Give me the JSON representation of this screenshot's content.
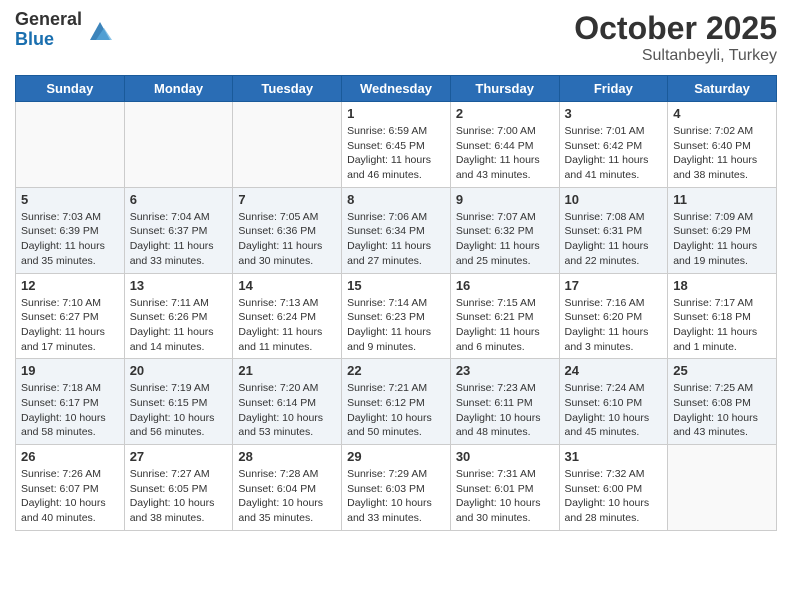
{
  "header": {
    "logo_general": "General",
    "logo_blue": "Blue",
    "month_title": "October 2025",
    "subtitle": "Sultanbeyli, Turkey"
  },
  "weekdays": [
    "Sunday",
    "Monday",
    "Tuesday",
    "Wednesday",
    "Thursday",
    "Friday",
    "Saturday"
  ],
  "weeks": [
    [
      {
        "day": "",
        "text": ""
      },
      {
        "day": "",
        "text": ""
      },
      {
        "day": "",
        "text": ""
      },
      {
        "day": "1",
        "text": "Sunrise: 6:59 AM\nSunset: 6:45 PM\nDaylight: 11 hours and 46 minutes."
      },
      {
        "day": "2",
        "text": "Sunrise: 7:00 AM\nSunset: 6:44 PM\nDaylight: 11 hours and 43 minutes."
      },
      {
        "day": "3",
        "text": "Sunrise: 7:01 AM\nSunset: 6:42 PM\nDaylight: 11 hours and 41 minutes."
      },
      {
        "day": "4",
        "text": "Sunrise: 7:02 AM\nSunset: 6:40 PM\nDaylight: 11 hours and 38 minutes."
      }
    ],
    [
      {
        "day": "5",
        "text": "Sunrise: 7:03 AM\nSunset: 6:39 PM\nDaylight: 11 hours and 35 minutes."
      },
      {
        "day": "6",
        "text": "Sunrise: 7:04 AM\nSunset: 6:37 PM\nDaylight: 11 hours and 33 minutes."
      },
      {
        "day": "7",
        "text": "Sunrise: 7:05 AM\nSunset: 6:36 PM\nDaylight: 11 hours and 30 minutes."
      },
      {
        "day": "8",
        "text": "Sunrise: 7:06 AM\nSunset: 6:34 PM\nDaylight: 11 hours and 27 minutes."
      },
      {
        "day": "9",
        "text": "Sunrise: 7:07 AM\nSunset: 6:32 PM\nDaylight: 11 hours and 25 minutes."
      },
      {
        "day": "10",
        "text": "Sunrise: 7:08 AM\nSunset: 6:31 PM\nDaylight: 11 hours and 22 minutes."
      },
      {
        "day": "11",
        "text": "Sunrise: 7:09 AM\nSunset: 6:29 PM\nDaylight: 11 hours and 19 minutes."
      }
    ],
    [
      {
        "day": "12",
        "text": "Sunrise: 7:10 AM\nSunset: 6:27 PM\nDaylight: 11 hours and 17 minutes."
      },
      {
        "day": "13",
        "text": "Sunrise: 7:11 AM\nSunset: 6:26 PM\nDaylight: 11 hours and 14 minutes."
      },
      {
        "day": "14",
        "text": "Sunrise: 7:13 AM\nSunset: 6:24 PM\nDaylight: 11 hours and 11 minutes."
      },
      {
        "day": "15",
        "text": "Sunrise: 7:14 AM\nSunset: 6:23 PM\nDaylight: 11 hours and 9 minutes."
      },
      {
        "day": "16",
        "text": "Sunrise: 7:15 AM\nSunset: 6:21 PM\nDaylight: 11 hours and 6 minutes."
      },
      {
        "day": "17",
        "text": "Sunrise: 7:16 AM\nSunset: 6:20 PM\nDaylight: 11 hours and 3 minutes."
      },
      {
        "day": "18",
        "text": "Sunrise: 7:17 AM\nSunset: 6:18 PM\nDaylight: 11 hours and 1 minute."
      }
    ],
    [
      {
        "day": "19",
        "text": "Sunrise: 7:18 AM\nSunset: 6:17 PM\nDaylight: 10 hours and 58 minutes."
      },
      {
        "day": "20",
        "text": "Sunrise: 7:19 AM\nSunset: 6:15 PM\nDaylight: 10 hours and 56 minutes."
      },
      {
        "day": "21",
        "text": "Sunrise: 7:20 AM\nSunset: 6:14 PM\nDaylight: 10 hours and 53 minutes."
      },
      {
        "day": "22",
        "text": "Sunrise: 7:21 AM\nSunset: 6:12 PM\nDaylight: 10 hours and 50 minutes."
      },
      {
        "day": "23",
        "text": "Sunrise: 7:23 AM\nSunset: 6:11 PM\nDaylight: 10 hours and 48 minutes."
      },
      {
        "day": "24",
        "text": "Sunrise: 7:24 AM\nSunset: 6:10 PM\nDaylight: 10 hours and 45 minutes."
      },
      {
        "day": "25",
        "text": "Sunrise: 7:25 AM\nSunset: 6:08 PM\nDaylight: 10 hours and 43 minutes."
      }
    ],
    [
      {
        "day": "26",
        "text": "Sunrise: 7:26 AM\nSunset: 6:07 PM\nDaylight: 10 hours and 40 minutes."
      },
      {
        "day": "27",
        "text": "Sunrise: 7:27 AM\nSunset: 6:05 PM\nDaylight: 10 hours and 38 minutes."
      },
      {
        "day": "28",
        "text": "Sunrise: 7:28 AM\nSunset: 6:04 PM\nDaylight: 10 hours and 35 minutes."
      },
      {
        "day": "29",
        "text": "Sunrise: 7:29 AM\nSunset: 6:03 PM\nDaylight: 10 hours and 33 minutes."
      },
      {
        "day": "30",
        "text": "Sunrise: 7:31 AM\nSunset: 6:01 PM\nDaylight: 10 hours and 30 minutes."
      },
      {
        "day": "31",
        "text": "Sunrise: 7:32 AM\nSunset: 6:00 PM\nDaylight: 10 hours and 28 minutes."
      },
      {
        "day": "",
        "text": ""
      }
    ]
  ]
}
